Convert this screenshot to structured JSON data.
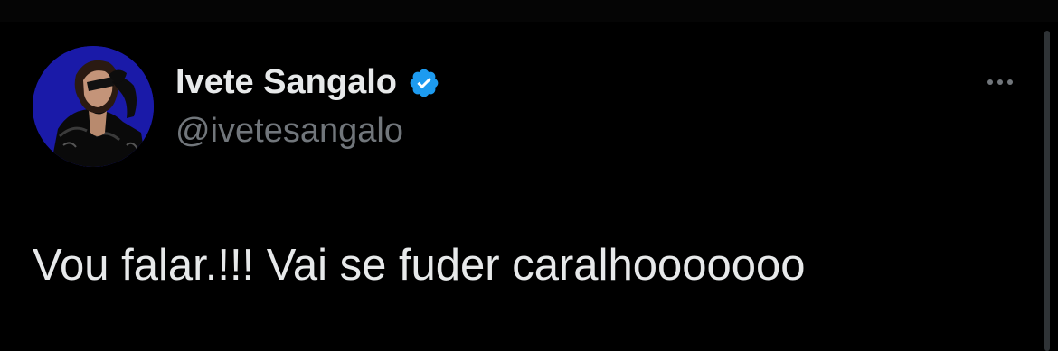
{
  "tweet": {
    "author": {
      "display_name": "Ivete Sangalo",
      "handle": "@ivetesangalo",
      "verified": true,
      "verified_icon": "verified-badge-icon",
      "avatar_icon": "avatar-photo"
    },
    "more_icon": "more-options-icon",
    "text": "Vou falar.!!! Vai se fuder caralhooooooo"
  },
  "colors": {
    "background": "#000000",
    "primary_text": "#e7e9ea",
    "secondary_text": "#71767b",
    "verified_blue": "#1d9bf0",
    "avatar_background": "#1a1aa8"
  }
}
